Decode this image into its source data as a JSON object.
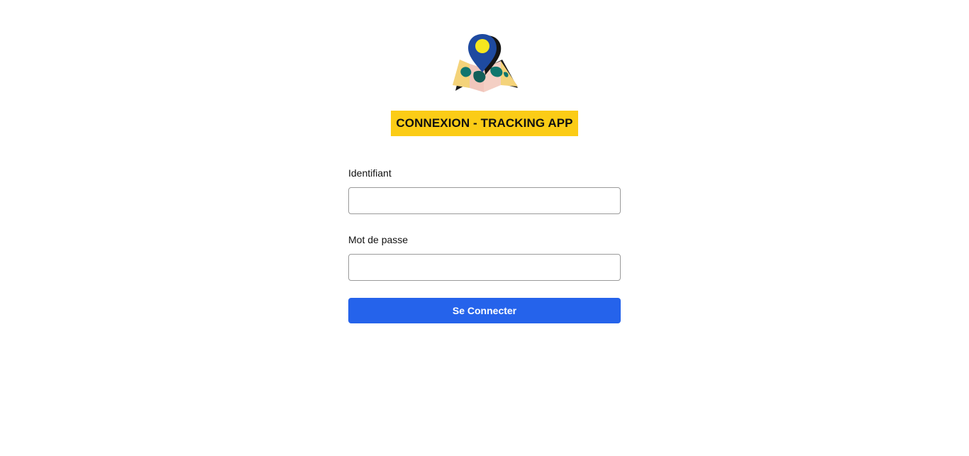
{
  "app": {
    "title": "CONNEXION - TRACKING APP",
    "logo_icon": "map-location-pin-icon"
  },
  "form": {
    "username_label": "Identifiant",
    "username_value": "",
    "password_label": "Mot de passe",
    "password_value": "",
    "submit_label": "Se Connecter"
  },
  "colors": {
    "accent_yellow": "#fbcc16",
    "button_blue": "#2563eb",
    "pin_blue": "#1e4aa0"
  }
}
